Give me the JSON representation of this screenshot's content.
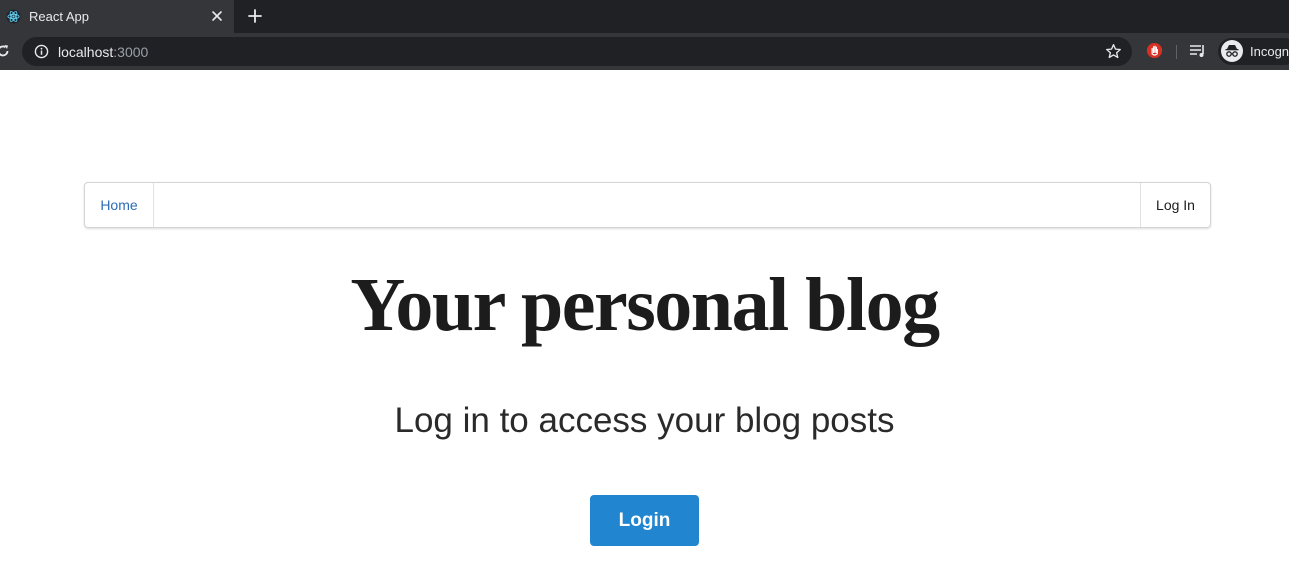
{
  "browser": {
    "tab_title": "React App",
    "url_host": "localhost",
    "url_port": ":3000",
    "profile_label": "Incognito"
  },
  "navbar": {
    "home_label": "Home",
    "login_label": "Log In"
  },
  "main": {
    "title": "Your personal blog",
    "subtitle": "Log in to access your blog posts",
    "login_button": "Login"
  },
  "colors": {
    "chrome_dark": "#202124",
    "chrome_tab": "#35363a",
    "link_blue": "#2c6cb6",
    "button_blue": "#2185d0"
  },
  "icons": [
    "react-favicon-icon",
    "close-icon",
    "plus-icon",
    "reload-icon",
    "info-icon",
    "star-icon",
    "hand-stop-icon",
    "media-queue-icon",
    "incognito-icon"
  ]
}
